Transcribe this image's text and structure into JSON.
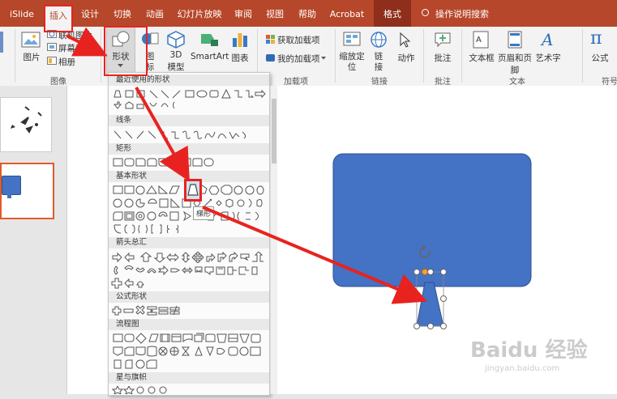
{
  "tabs": [
    "iSlide",
    "插入",
    "设计",
    "切换",
    "动画",
    "幻灯片放映",
    "审阅",
    "视图",
    "帮助",
    "Acrobat",
    "格式"
  ],
  "tell_me": "操作说明搜索",
  "ribbon": {
    "picture": "图片",
    "online_picture": "联机图片",
    "screenshot": "屏幕截图",
    "album": "相册",
    "images_group": "图像",
    "shapes": "形状",
    "icons_a": "图",
    "icons_b": "标",
    "model_a": "3D",
    "model_b": "模型",
    "smartart": "SmartArt",
    "chart": "图表",
    "get_addins": "获取加载项",
    "my_addins": "我的加载项",
    "addins_group": "加载项",
    "zoom_a": "缩放定",
    "zoom_b": "位",
    "link_a": "链",
    "link_b": "接",
    "action": "动作",
    "links_group": "链接",
    "comment": "批注",
    "comments_group": "批注",
    "textbox": "文本框",
    "header_footer": "页眉和页脚",
    "wordart": "艺术字",
    "text_group": "文本",
    "equation": "公式",
    "symbols_group": "符号"
  },
  "shapes_menu": {
    "recent": "最近使用的形状",
    "lines": "线条",
    "rect": "矩形",
    "basic": "基本形状",
    "arrows": "箭头总汇",
    "equation": "公式形状",
    "flowchart": "流程图",
    "stars": "星与旗帜"
  },
  "tooltip": "梯形",
  "watermark": {
    "brand": "Baidu 经验",
    "url": "jingyan.baidu.com"
  },
  "colors": {
    "ribbon_red": "#b7472a",
    "shape_blue": "#4472c4",
    "callout_red": "#e8231f"
  }
}
